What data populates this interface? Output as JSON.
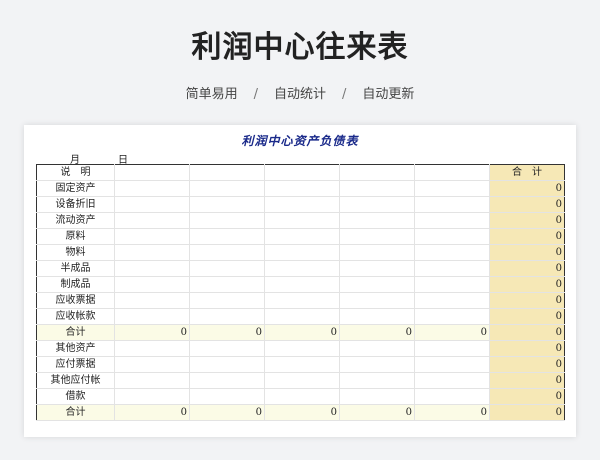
{
  "page": {
    "title": "利润中心往来表",
    "features": [
      "简单易用",
      "自动统计",
      "自动更新"
    ],
    "separator": "/"
  },
  "sheet": {
    "title": "利润中心资产负债表",
    "month_label": "月",
    "day_label": "日",
    "header": {
      "desc": "说　明",
      "total": "合　计"
    },
    "rows": [
      {
        "label": "固定资产",
        "values": [
          "",
          "",
          "",
          "",
          ""
        ],
        "total": "0",
        "subtotal": false
      },
      {
        "label": "设备折旧",
        "values": [
          "",
          "",
          "",
          "",
          ""
        ],
        "total": "0",
        "subtotal": false
      },
      {
        "label": "流动资产",
        "values": [
          "",
          "",
          "",
          "",
          ""
        ],
        "total": "0",
        "subtotal": false
      },
      {
        "label": "原料",
        "values": [
          "",
          "",
          "",
          "",
          ""
        ],
        "total": "0",
        "subtotal": false
      },
      {
        "label": "物料",
        "values": [
          "",
          "",
          "",
          "",
          ""
        ],
        "total": "0",
        "subtotal": false
      },
      {
        "label": "半成品",
        "values": [
          "",
          "",
          "",
          "",
          ""
        ],
        "total": "0",
        "subtotal": false
      },
      {
        "label": "制成品",
        "values": [
          "",
          "",
          "",
          "",
          ""
        ],
        "total": "0",
        "subtotal": false
      },
      {
        "label": "应收票据",
        "values": [
          "",
          "",
          "",
          "",
          ""
        ],
        "total": "0",
        "subtotal": false
      },
      {
        "label": "应收帐款",
        "values": [
          "",
          "",
          "",
          "",
          ""
        ],
        "total": "0",
        "subtotal": false
      },
      {
        "label": "合计",
        "values": [
          "0",
          "0",
          "0",
          "0",
          "0"
        ],
        "total": "0",
        "subtotal": true
      },
      {
        "label": "其他资产",
        "values": [
          "",
          "",
          "",
          "",
          ""
        ],
        "total": "0",
        "subtotal": false
      },
      {
        "label": "应付票据",
        "values": [
          "",
          "",
          "",
          "",
          ""
        ],
        "total": "0",
        "subtotal": false
      },
      {
        "label": "其他应付帐",
        "values": [
          "",
          "",
          "",
          "",
          ""
        ],
        "total": "0",
        "subtotal": false
      },
      {
        "label": "借款",
        "values": [
          "",
          "",
          "",
          "",
          ""
        ],
        "total": "0",
        "subtotal": false
      },
      {
        "label": "合计",
        "values": [
          "0",
          "0",
          "0",
          "0",
          "0"
        ],
        "total": "0",
        "subtotal": true
      }
    ]
  }
}
